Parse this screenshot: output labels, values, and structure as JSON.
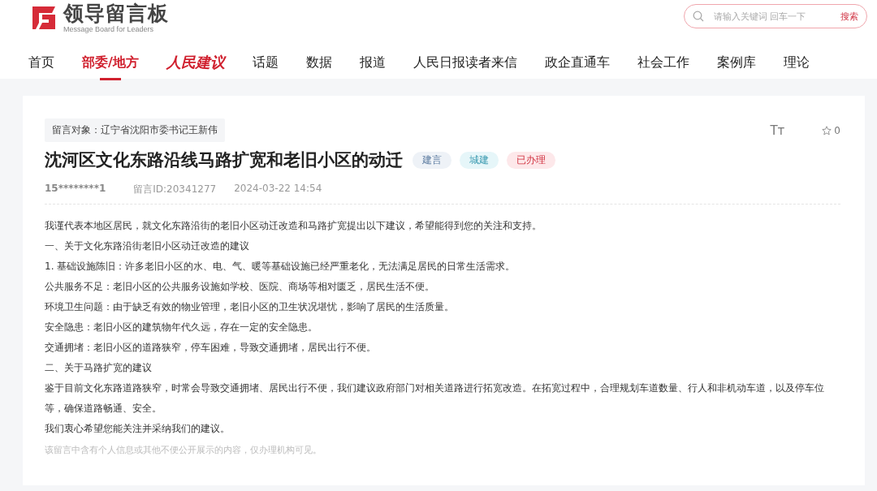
{
  "header": {
    "logo_title": "领导留言板",
    "logo_subtitle": "Message Board for Leaders",
    "search": {
      "placeholder": "请输入关键词 回车一下",
      "button": "搜索"
    }
  },
  "nav": [
    {
      "label": "首页",
      "kind": "text",
      "selected": false
    },
    {
      "label": "部委/地方",
      "kind": "text",
      "selected": true
    },
    {
      "label": "人民建议",
      "kind": "brand",
      "selected": false
    },
    {
      "label": "话题",
      "kind": "text",
      "selected": false
    },
    {
      "label": "数据",
      "kind": "text",
      "selected": false
    },
    {
      "label": "报道",
      "kind": "text",
      "selected": false
    },
    {
      "label": "人民日报读者来信",
      "kind": "text",
      "selected": false
    },
    {
      "label": "政企直通车",
      "kind": "text",
      "selected": false
    },
    {
      "label": "社会工作",
      "kind": "text",
      "selected": false
    },
    {
      "label": "案例库",
      "kind": "text",
      "selected": false
    },
    {
      "label": "理论",
      "kind": "text",
      "selected": false
    }
  ],
  "message": {
    "recipient": "留言对象：辽宁省沈阳市委书记王新伟",
    "font_size_label": "Tт",
    "favorites": "0",
    "title": "沈河区文化东路沿线马路扩宽和老旧小区的动迁",
    "tags": [
      {
        "label": "建言",
        "color": "#eef2f7"
      },
      {
        "label": "城建",
        "color": "#e6f6f9"
      },
      {
        "label": "已办理",
        "color": "#fde8ea"
      }
    ],
    "author": "15********1",
    "message_id": "留言ID:20341277",
    "time": "2024-03-22 14:54",
    "paragraphs": [
      "我谨代表本地区居民，就文化东路沿街的老旧小区动迁改造和马路扩宽提出以下建议，希望能得到您的关注和支持。",
      "一、关于文化东路沿街老旧小区动迁改造的建议",
      "1. 基础设施陈旧：许多老旧小区的水、电、气、暖等基础设施已经严重老化，无法满足居民的日常生活需求。",
      "公共服务不足：老旧小区的公共服务设施如学校、医院、商场等相对匮乏，居民生活不便。",
      "环境卫生问题：由于缺乏有效的物业管理，老旧小区的卫生状况堪忧，影响了居民的生活质量。",
      "安全隐患：老旧小区的建筑物年代久远，存在一定的安全隐患。",
      "交通拥堵：老旧小区的道路狭窄，停车困难，导致交通拥堵，居民出行不便。",
      "二、关于马路扩宽的建议",
      "鉴于目前文化东路道路狭窄，时常会导致交通拥堵、居民出行不便，我们建议政府部门对相关道路进行拓宽改造。在拓宽过程中，合理规划车道数量、行人和非机动车道，以及停车位等，确保道路畅通、安全。",
      "我们衷心希望您能关注并采纳我们的建议。"
    ],
    "privacy_note": "该留言中含有个人信息或其他不便公开展示的内容，仅办理机构可见。"
  }
}
